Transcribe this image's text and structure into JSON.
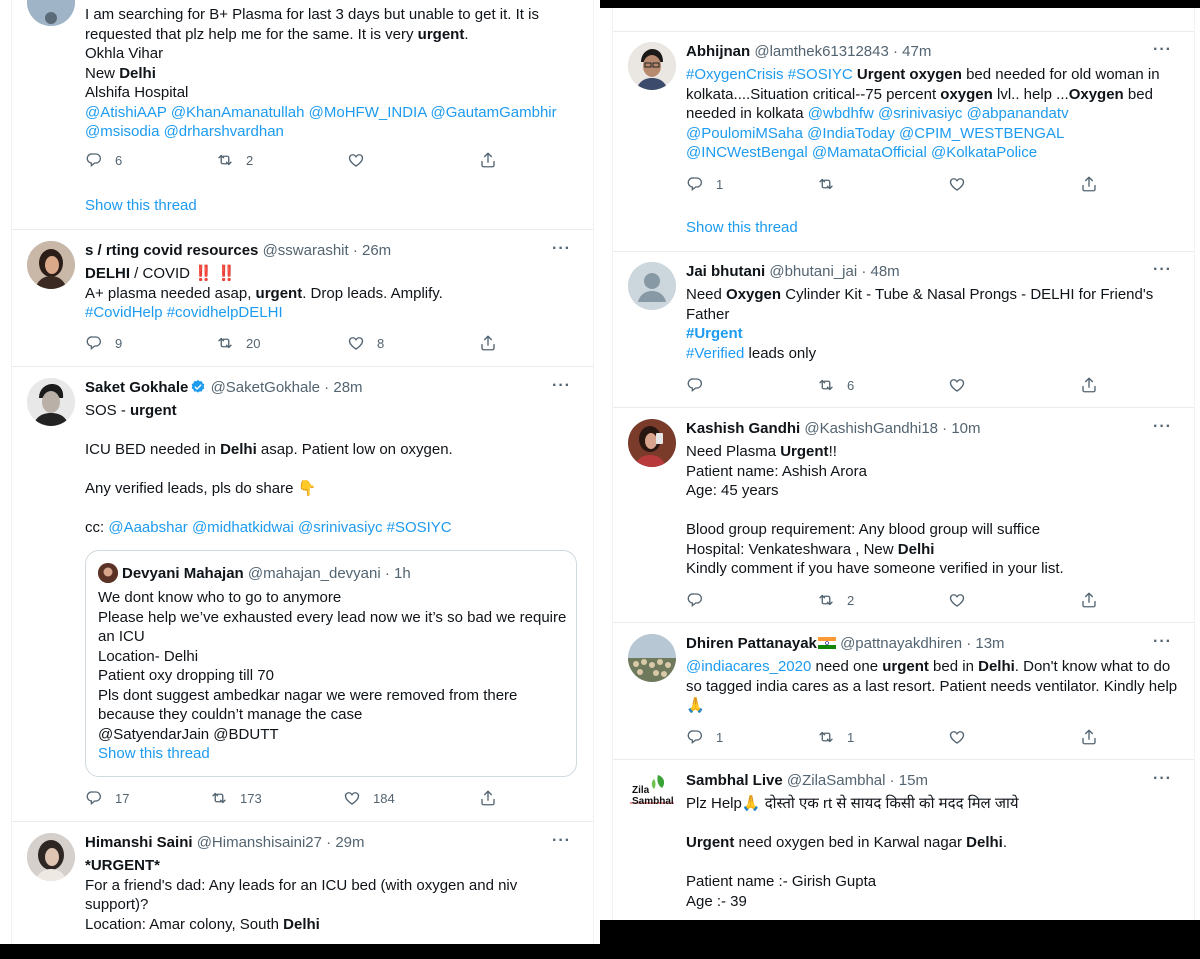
{
  "left": {
    "tweets": [
      {
        "id": "plasma-b",
        "body_lines": [
          "I am searching for B+ Plasma for last 3 days but unable to get it. It is",
          "requested that plz help me for the same. It is very ",
          "Okhla Vihar",
          "New ",
          "Alshifa Hospital",
          "@AtishiAAP @KhanAmanatullah @MoHFW_INDIA @GautamGambhir",
          "@msisodia @drharshvardhan"
        ],
        "bold_urgent": "urgent",
        "period": ".",
        "bold_delhi": "Delhi",
        "replies": "6",
        "retweets": "2",
        "likes": "",
        "show_thread": "Show this thread"
      },
      {
        "id": "sswarashit",
        "name": "s / rting covid resources",
        "handle": "@sswarashit · 26m",
        "line1_bold": "DELHI",
        "line1_rest": " / COVID ",
        "line1_emoji": "‼️ ‼️",
        "line2_a": "A+ plasma needed asap, ",
        "line2_bold": "urgent",
        "line2_b": ". Drop leads. Amplify.",
        "line3": "#CovidHelp  #covidhelpDELHI",
        "replies": "9",
        "retweets": "20",
        "likes": "8"
      },
      {
        "id": "saketgokhale",
        "name": "Saket Gokhale",
        "handle": "@SaketGokhale · 28m",
        "l1a": "SOS - ",
        "l1b": "urgent",
        "l2a": "ICU BED needed in ",
        "l2b": "Delhi",
        "l2c": " asap. Patient low on oxygen.",
        "l3": "Any verified leads, pls do share 👇",
        "l4a": "cc: ",
        "l4b": "@Aaabshar @midhatkidwai @srinivasiyc #SOSIYC",
        "quote": {
          "name": "Devyani Mahajan",
          "handle": "@mahajan_devyani · 1h",
          "lines": [
            "We dont know who to go to anymore",
            "Please help we’ve exhausted every lead now we it’s so bad we require",
            "an ICU",
            "Location- Delhi",
            "Patient oxy dropping till 70",
            "Pls dont suggest ambedkar nagar we were removed from there",
            "because they couldn’t manage the case",
            "@SatyendarJain @BDUTT"
          ],
          "show_thread": "Show this thread"
        },
        "replies": "17",
        "retweets": "173",
        "likes": "184"
      },
      {
        "id": "himanshisaini",
        "name": "Himanshi Saini",
        "handle": "@Himanshisaini27 · 29m",
        "l1": "*URGENT*",
        "l2": "For a friend's dad: Any leads for an ICU bed (with oxygen and niv",
        "l3": "support)?",
        "l4a": "Location: Amar colony, South ",
        "l4b": "Delhi"
      }
    ]
  },
  "right": {
    "tweets": [
      {
        "id": "abhijnan",
        "name": "Abhijnan",
        "handle": "@lamthek61312843 · 47m",
        "l1a": "#OxygenCrisis #SOSIYC",
        "l1b": " Urgent oxygen",
        "l1c": " bed needed for old woman in",
        "l2a": "kolkata....Situation critical--75 percent ",
        "l2b": "oxygen",
        "l2c": " lvl.. help ...",
        "l2d": "Oxygen",
        "l2e": " bed",
        "l3a": "needed in kolkata ",
        "l3b": "@wbdhfw @srinivasiyc @abpanandatv",
        "l4": "@PoulomiMSaha @IndiaToday @CPIM_WESTBENGAL",
        "l5": "@INCWestBengal @MamataOfficial @KolkataPolice",
        "replies": "1",
        "retweets": "",
        "likes": "",
        "show_thread": "Show this thread"
      },
      {
        "id": "bhutani",
        "name": "Jai bhutani",
        "handle": "@bhutani_jai · 48m",
        "l1a": "Need ",
        "l1b": "Oxygen",
        "l1c": " Cylinder Kit - Tube & Nasal Prongs - DELHI for Friend's",
        "l2": "Father",
        "l3": "#Urgent",
        "l4a": "#Verified",
        "l4b": " leads only",
        "replies": "",
        "retweets": "6",
        "likes": ""
      },
      {
        "id": "kashish",
        "name": "Kashish Gandhi",
        "handle": "@KashishGandhi18 · 10m",
        "l1a": "Need Plasma ",
        "l1b": "Urgent",
        "l1c": "!!",
        "l2": "Patient name: Ashish Arora",
        "l3": "Age: 45 years",
        "l4": "Blood group requirement: Any blood group will suffice",
        "l5a": "Hospital: Venkateshwara , New ",
        "l5b": "Delhi",
        "l6": "Kindly comment if you have someone verified in your list.",
        "replies": "",
        "retweets": "2",
        "likes": ""
      },
      {
        "id": "dhiren",
        "name": "Dhiren Pattanayak",
        "handle": "@pattnayakdhiren · 13m",
        "l1a": "@indiacares_2020",
        "l1b": " need one ",
        "l1c": "urgent",
        "l1d": " bed in ",
        "l1e": "Delhi",
        "l1f": ". Don't know what to do",
        "l2": "so tagged india cares as a last resort. Patient needs ventilator. Kindly help",
        "l3": "🙏",
        "replies": "1",
        "retweets": "1",
        "likes": ""
      },
      {
        "id": "zilasambhal",
        "name": "Sambhal Live",
        "handle": "@ZilaSambhal · 15m",
        "logo_line1": "Zila",
        "logo_line2": "Sambhal",
        "l1": "Plz Help🙏 दोस्तो एक rt से सायद किसी को मदद मिल जाये",
        "l2a": "Urgent",
        "l2b": " need oxygen bed in Karwal nagar ",
        "l2c": "Delhi",
        "l2d": ".",
        "l3": "Patient name :- Girish Gupta",
        "l4": "Age :- 39"
      }
    ]
  },
  "more_glyph": "···"
}
